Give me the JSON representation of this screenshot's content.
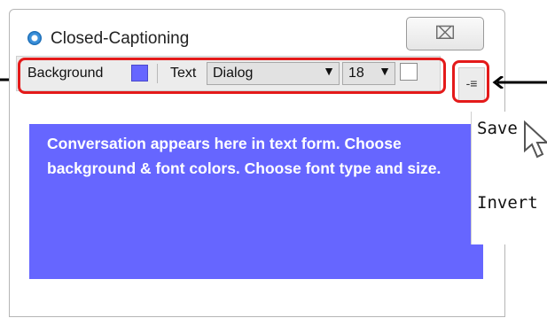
{
  "window": {
    "title": "Closed-Captioning",
    "close_symbol": "⌧"
  },
  "toolbar": {
    "background_label": "Background",
    "background_color": "#6666ff",
    "text_label": "Text",
    "font_value": "Dialog",
    "size_value": "18",
    "dropdown_arrow": "▼",
    "menu_symbol": "-≡"
  },
  "caption": {
    "background": "#6666ff",
    "text_color": "#ffffff",
    "text": "Conversation appears here in text form. Choose background & font colors.  Choose font type and size."
  },
  "popup_menu": {
    "items": [
      "Save",
      "Invert"
    ]
  },
  "annotations": {
    "highlight_color": "#e41a1a"
  }
}
